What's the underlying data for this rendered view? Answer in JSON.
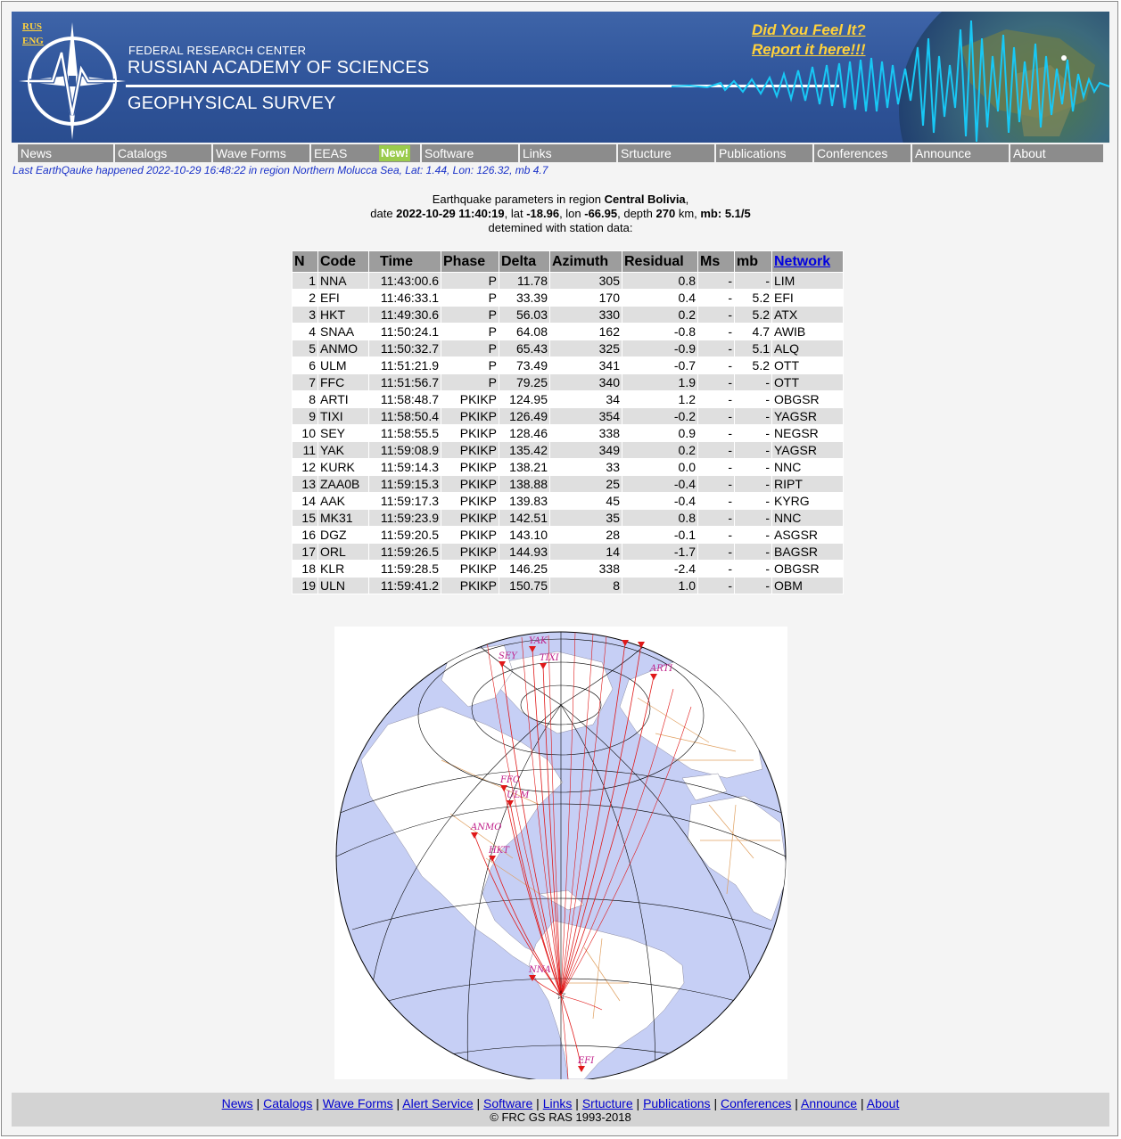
{
  "lang": {
    "rus": "RUS",
    "eng": "ENG"
  },
  "header": {
    "org_line1": "FEDERAL RESEARCH CENTER",
    "org_line2": "RUSSIAN ACADEMY OF SCIENCES",
    "org_line3": "GEOPHYSICAL SURVEY",
    "feel_line1": "Did You Feel It?",
    "feel_line2": "Report it here!!!"
  },
  "nav": {
    "items": [
      "News",
      "Catalogs",
      "Wave Forms",
      "EEAS",
      "Software",
      "Links",
      "Srtucture",
      "Publications",
      "Conferences",
      "Announce",
      "About"
    ],
    "new_badge": "New!"
  },
  "last_quake": "Last EarthQauke happened 2022-10-29 16:48:22 in region Northern Molucca Sea, Lat: 1.44, Lon: 126.32, mb 4.7",
  "event": {
    "line1_prefix": "Earthquake parameters in region ",
    "region": "Central Bolivia",
    "line1_suffix": ",",
    "date_label": "date ",
    "date": "2022-10-29 11:40:19",
    "lat_label": ", lat ",
    "lat": "-18.96",
    "lon_label": ", lon ",
    "lon": "-66.95",
    "depth_label": ", depth ",
    "depth": "270",
    "km_label": " km, ",
    "mb_label": "mb: 5.1/5",
    "line3": "detemined with station data:"
  },
  "table": {
    "headers": [
      "N",
      "Code",
      "Time",
      "Phase",
      "Delta",
      "Azimuth",
      "Residual",
      "Ms",
      "mb",
      "Network"
    ],
    "rows": [
      [
        "1",
        "NNA",
        "11:43:00.6",
        "P",
        "11.78",
        "305",
        "0.8",
        "-",
        "-",
        "LIM"
      ],
      [
        "2",
        "EFI",
        "11:46:33.1",
        "P",
        "33.39",
        "170",
        "0.4",
        "-",
        "5.2",
        "EFI"
      ],
      [
        "3",
        "HKT",
        "11:49:30.6",
        "P",
        "56.03",
        "330",
        "0.2",
        "-",
        "5.2",
        "ATX"
      ],
      [
        "4",
        "SNAA",
        "11:50:24.1",
        "P",
        "64.08",
        "162",
        "-0.8",
        "-",
        "4.7",
        "AWIB"
      ],
      [
        "5",
        "ANMO",
        "11:50:32.7",
        "P",
        "65.43",
        "325",
        "-0.9",
        "-",
        "5.1",
        "ALQ"
      ],
      [
        "6",
        "ULM",
        "11:51:21.9",
        "P",
        "73.49",
        "341",
        "-0.7",
        "-",
        "5.2",
        "OTT"
      ],
      [
        "7",
        "FFC",
        "11:51:56.7",
        "P",
        "79.25",
        "340",
        "1.9",
        "-",
        "-",
        "OTT"
      ],
      [
        "8",
        "ARTI",
        "11:58:48.7",
        "PKIKP",
        "124.95",
        "34",
        "1.2",
        "-",
        "-",
        "OBGSR"
      ],
      [
        "9",
        "TIXI",
        "11:58:50.4",
        "PKIKP",
        "126.49",
        "354",
        "-0.2",
        "-",
        "-",
        "YAGSR"
      ],
      [
        "10",
        "SEY",
        "11:58:55.5",
        "PKIKP",
        "128.46",
        "338",
        "0.9",
        "-",
        "-",
        "NEGSR"
      ],
      [
        "11",
        "YAK",
        "11:59:08.9",
        "PKIKP",
        "135.42",
        "349",
        "0.2",
        "-",
        "-",
        "YAGSR"
      ],
      [
        "12",
        "KURK",
        "11:59:14.3",
        "PKIKP",
        "138.21",
        "33",
        "0.0",
        "-",
        "-",
        "NNC"
      ],
      [
        "13",
        "ZAA0B",
        "11:59:15.3",
        "PKIKP",
        "138.88",
        "25",
        "-0.4",
        "-",
        "-",
        "RIPT"
      ],
      [
        "14",
        "AAK",
        "11:59:17.3",
        "PKIKP",
        "139.83",
        "45",
        "-0.4",
        "-",
        "-",
        "KYRG"
      ],
      [
        "15",
        "MK31",
        "11:59:23.9",
        "PKIKP",
        "142.51",
        "35",
        "0.8",
        "-",
        "-",
        "NNC"
      ],
      [
        "16",
        "DGZ",
        "11:59:20.5",
        "PKIKP",
        "143.10",
        "28",
        "-0.1",
        "-",
        "-",
        "ASGSR"
      ],
      [
        "17",
        "ORL",
        "11:59:26.5",
        "PKIKP",
        "144.93",
        "14",
        "-1.7",
        "-",
        "-",
        "BAGSR"
      ],
      [
        "18",
        "KLR",
        "11:59:28.5",
        "PKIKP",
        "146.25",
        "338",
        "-2.4",
        "-",
        "-",
        "OBGSR"
      ],
      [
        "19",
        "ULN",
        "11:59:41.2",
        "PKIKP",
        "150.75",
        "8",
        "1.0",
        "-",
        "-",
        "OBM"
      ]
    ]
  },
  "map": {
    "labels": [
      "YAK",
      "SEY",
      "TIXI",
      "ARTI",
      "FFC",
      "ULM",
      "ANMO",
      "HKT",
      "NNA",
      "EFI"
    ]
  },
  "footer": {
    "links": [
      "News",
      "Catalogs",
      "Wave Forms",
      "Alert Service",
      "Software",
      "Links",
      "Srtucture",
      "Publications",
      "Conferences",
      "Announce",
      "About"
    ],
    "copyright": "© FRC GS RAS 1993-2018"
  },
  "colors": {
    "banner": "#2f549a",
    "accent": "#ffd23c",
    "nav": "#8c8c8c",
    "link": "#0000d0",
    "ray": "#e01818",
    "ocean": "#c6cff5"
  }
}
